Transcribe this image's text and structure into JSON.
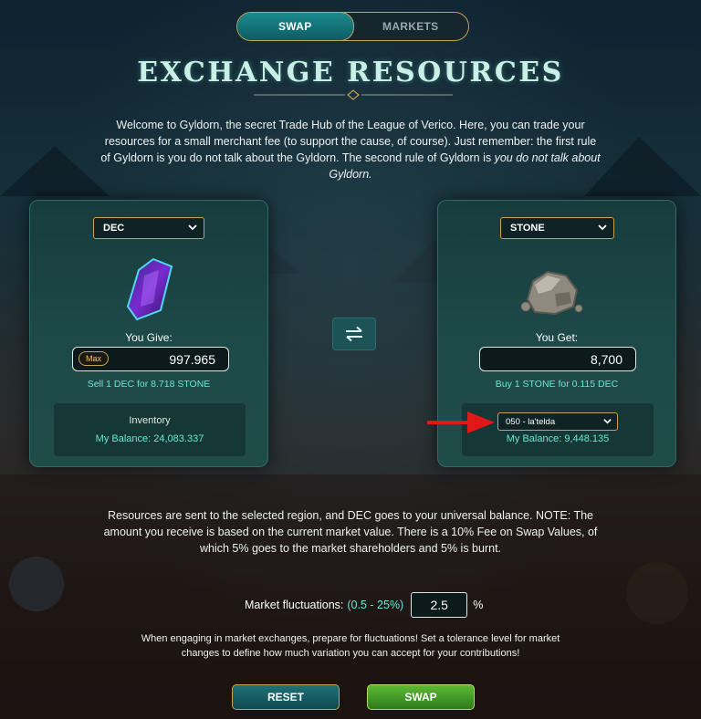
{
  "tabs": [
    {
      "label": "SWAP"
    },
    {
      "label": "MARKETS"
    }
  ],
  "title": "EXCHANGE RESOURCES",
  "intro": {
    "text": "Welcome to Gyldorn, the secret Trade Hub of the League of Verico. Here, you can trade your resources for a small merchant fee (to support the cause, of course). Just remember: the first rule of Gyldorn is you do not talk about the Gyldorn. The second rule of Gyldorn is ",
    "emphasis": "you do not talk about Gyldorn."
  },
  "give": {
    "resource": "DEC",
    "label": "You Give:",
    "max_label": "Max",
    "amount": "997.965",
    "rate": "Sell 1 DEC for 8.718 STONE",
    "inventory_title": "Inventory",
    "balance": "My Balance: 24,083.337",
    "icon": "purple-crystal-icon"
  },
  "get": {
    "resource": "STONE",
    "label": "You Get:",
    "amount": "8,700",
    "rate": "Buy 1 STONE for 0.115 DEC",
    "region": "050 - la'telda",
    "balance": "My Balance: 9,448.135",
    "icon": "stone-icon"
  },
  "note": "Resources are sent to the selected region, and DEC goes to your universal balance. NOTE: The amount you receive is based on the current market value. There is a 10% Fee on Swap Values, of which 5% goes to the market shareholders and 5% is burnt.",
  "fluctuation": {
    "label": "Market fluctuations:",
    "range": "(0.5 - 25%)",
    "value": "2.5",
    "unit": "%"
  },
  "hint": "When engaging in market exchanges, prepare for fluctuations! Set a tolerance level for market changes to define how much variation you can accept for your contributions!",
  "buttons": {
    "reset": "RESET",
    "swap": "SWAP"
  },
  "colors": {
    "accent_teal": "#67e8d4",
    "gold_border": "#c8a24e",
    "swap_green": "#5dbb35",
    "annotation_arrow": "#e01818"
  }
}
